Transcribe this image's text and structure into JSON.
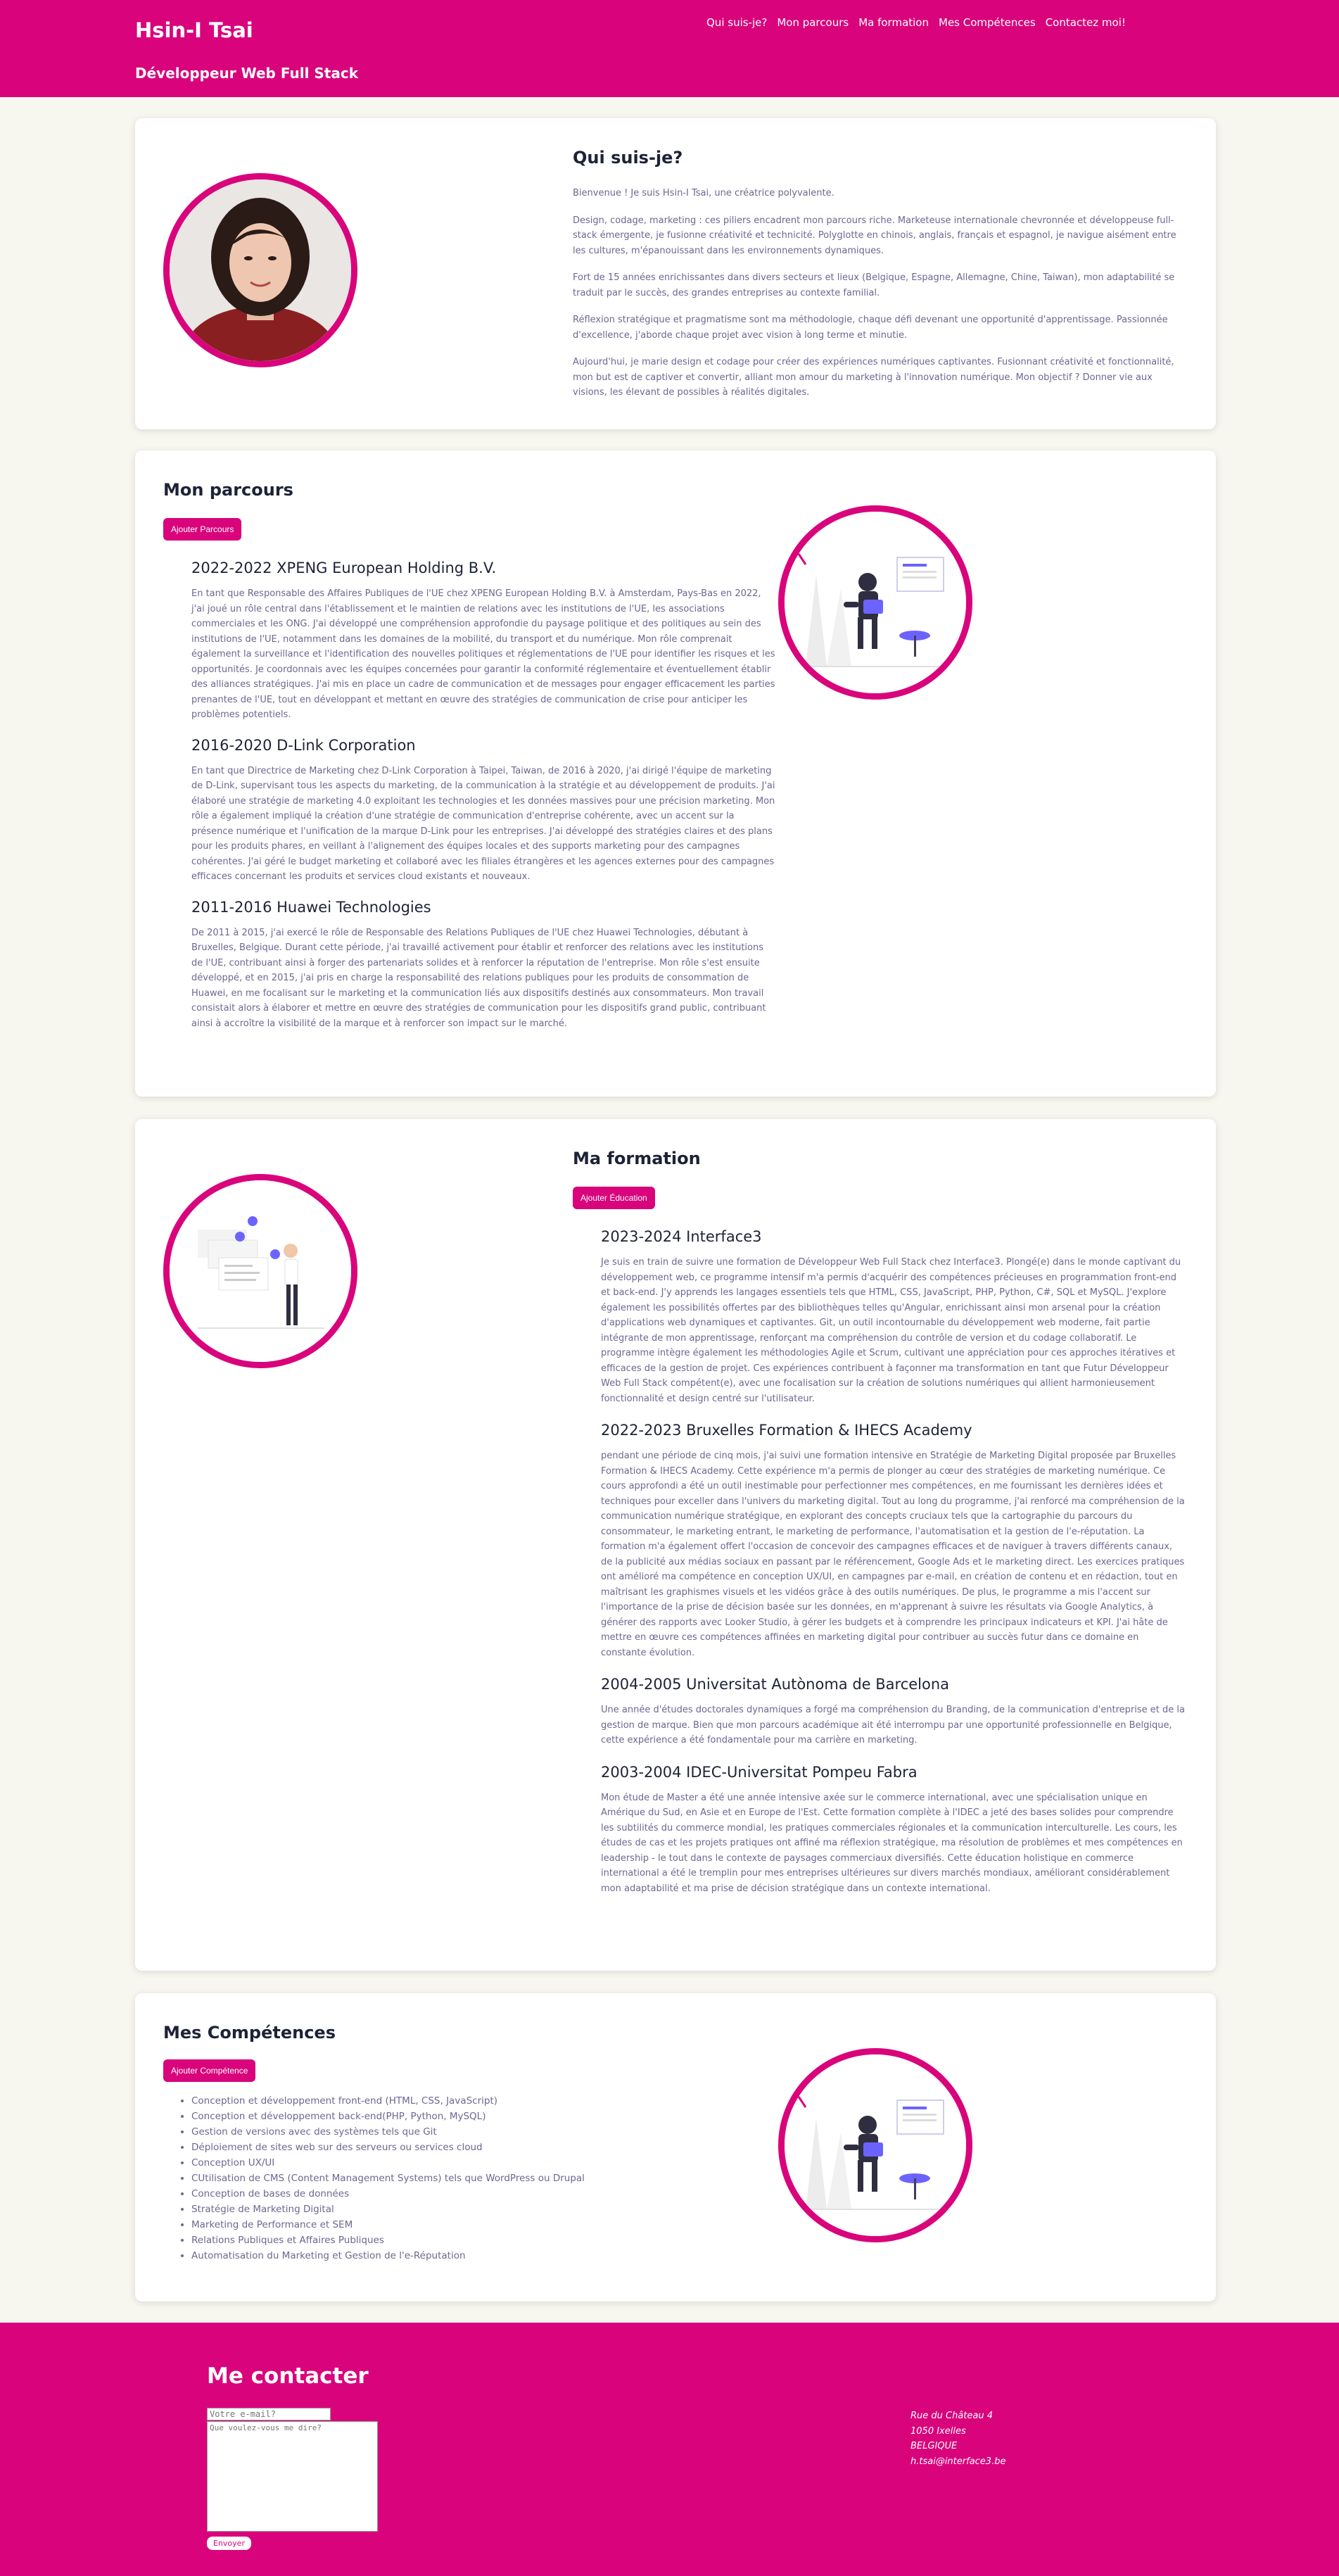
{
  "header": {
    "name": "Hsin-I Tsai",
    "role": "Développeur Web Full Stack",
    "nav": [
      "Qui suis-je?",
      "Mon parcours",
      "Ma formation",
      "Mes Compétences",
      "Contactez moi!"
    ]
  },
  "about": {
    "title": "Qui suis-je?",
    "paragraphs": [
      "Bienvenue ! Je suis Hsin-I Tsai, une créatrice polyvalente.",
      "Design, codage, marketing : ces piliers encadrent mon parcours riche. Marketeuse internationale chevronnée et développeuse full-stack émergente, je fusionne créativité et technicité. Polyglotte en chinois, anglais, français et espagnol, je navigue aisément entre les cultures, m'épanouissant dans les environnements dynamiques.",
      "Fort de 15 années enrichissantes dans divers secteurs et lieux (Belgique, Espagne, Allemagne, Chine, Taiwan), mon adaptabilité se traduit par le succès, des grandes entreprises au contexte familial.",
      "Réflexion stratégique et pragmatisme sont ma méthodologie, chaque défi devenant une opportunité d'apprentissage. Passionnée d'excellence, j'aborde chaque projet avec vision à long terme et minutie.",
      "Aujourd'hui, je marie design et codage pour créer des expériences numériques captivantes. Fusionnant créativité et fonctionnalité, mon but est de captiver et convertir, alliant mon amour du marketing à l'innovation numérique. Mon objectif ? Donner vie aux visions, les élevant de possibles à réalités digitales."
    ]
  },
  "parcours": {
    "title": "Mon parcours",
    "add_label": "Ajouter Parcours",
    "items": [
      {
        "title": "2022-2022 XPENG European Holding B.V.",
        "text": "En tant que Responsable des Affaires Publiques de l'UE chez XPENG European Holding B.V. à Amsterdam, Pays-Bas en 2022, j'ai joué un rôle central dans l'établissement et le maintien de relations avec les institutions de l'UE, les associations commerciales et les ONG. J'ai développé une compréhension approfondie du paysage politique et des politiques au sein des institutions de l'UE, notamment dans les domaines de la mobilité, du transport et du numérique. Mon rôle comprenait également la surveillance et l'identification des nouvelles politiques et réglementations de l'UE pour identifier les risques et les opportunités. Je coordonnais avec les équipes concernées pour garantir la conformité réglementaire et éventuellement établir des alliances stratégiques. J'ai mis en place un cadre de communication et de messages pour engager efficacement les parties prenantes de l'UE, tout en développant et mettant en œuvre des stratégies de communication de crise pour anticiper les problèmes potentiels."
      },
      {
        "title": "2016-2020 D-Link Corporation",
        "text": "En tant que Directrice de Marketing chez D-Link Corporation à Taipei, Taiwan, de 2016 à 2020, j'ai dirigé l'équipe de marketing de D-Link, supervisant tous les aspects du marketing, de la communication à la stratégie et au développement de produits. J'ai élaboré une stratégie de marketing 4.0 exploitant les technologies et les données massives pour une précision marketing. Mon rôle a également impliqué la création d'une stratégie de communication d'entreprise cohérente, avec un accent sur la présence numérique et l'unification de la marque D-Link pour les entreprises. J'ai développé des stratégies claires et des plans pour les produits phares, en veillant à l'alignement des équipes locales et des supports marketing pour des campagnes cohérentes. J'ai géré le budget marketing et collaboré avec les filiales étrangères et les agences externes pour des campagnes efficaces concernant les produits et services cloud existants et nouveaux."
      },
      {
        "title": "2011-2016 Huawei Technologies",
        "text": "De 2011 à 2015, j'ai exercé le rôle de Responsable des Relations Publiques de l'UE chez Huawei Technologies, débutant à Bruxelles, Belgique. Durant cette période, j'ai travaillé activement pour établir et renforcer des relations avec les institutions de l'UE, contribuant ainsi à forger des partenariats solides et à renforcer la réputation de l'entreprise. Mon rôle s'est ensuite développé, et en 2015, j'ai pris en charge la responsabilité des relations publiques pour les produits de consommation de Huawei, en me focalisant sur le marketing et la communication liés aux dispositifs destinés aux consommateurs. Mon travail consistait alors à élaborer et mettre en œuvre des stratégies de communication pour les dispositifs grand public, contribuant ainsi à accroître la visibilité de la marque et à renforcer son impact sur le marché."
      }
    ]
  },
  "formation": {
    "title": "Ma formation",
    "add_label": "Ajouter Éducation",
    "items": [
      {
        "title": "2023-2024 Interface3",
        "text": "Je suis en train de suivre une formation de Développeur Web Full Stack chez Interface3. Plongé(e) dans le monde captivant du développement web, ce programme intensif m'a permis d'acquérir des compétences précieuses en programmation front-end et back-end. J'y apprends les langages essentiels tels que HTML, CSS, JavaScript, PHP, Python, C#, SQL et MySQL. J'explore également les possibilités offertes par des bibliothèques telles qu'Angular, enrichissant ainsi mon arsenal pour la création d'applications web dynamiques et captivantes. Git, un outil incontournable du développement web moderne, fait partie intégrante de mon apprentissage, renforçant ma compréhension du contrôle de version et du codage collaboratif. Le programme intègre également les méthodologies Agile et Scrum, cultivant une appréciation pour ces approches itératives et efficaces de la gestion de projet. Ces expériences contribuent à façonner ma transformation en tant que Futur Développeur Web Full Stack compétent(e), avec une focalisation sur la création de solutions numériques qui allient harmonieusement fonctionnalité et design centré sur l'utilisateur."
      },
      {
        "title": "2022-2023 Bruxelles Formation & IHECS Academy",
        "text": "pendant une période de cinq mois, j'ai suivi une formation intensive en Stratégie de Marketing Digital proposée par Bruxelles Formation & IHECS Academy. Cette expérience m'a permis de plonger au cœur des stratégies de marketing numérique. Ce cours approfondi a été un outil inestimable pour perfectionner mes compétences, en me fournissant les dernières idées et techniques pour exceller dans l'univers du marketing digital. Tout au long du programme, j'ai renforcé ma compréhension de la communication numérique stratégique, en explorant des concepts cruciaux tels que la cartographie du parcours du consommateur, le marketing entrant, le marketing de performance, l'automatisation et la gestion de l'e-réputation. La formation m'a également offert l'occasion de concevoir des campagnes efficaces et de naviguer à travers différents canaux, de la publicité aux médias sociaux en passant par le référencement, Google Ads et le marketing direct. Les exercices pratiques ont amélioré ma compétence en conception UX/UI, en campagnes par e-mail, en création de contenu et en rédaction, tout en maîtrisant les graphismes visuels et les vidéos grâce à des outils numériques. De plus, le programme a mis l'accent sur l'importance de la prise de décision basée sur les données, en m'apprenant à suivre les résultats via Google Analytics, à générer des rapports avec Looker Studio, à gérer les budgets et à comprendre les principaux indicateurs et KPI. J'ai hâte de mettre en œuvre ces compétences affinées en marketing digital pour contribuer au succès futur dans ce domaine en constante évolution."
      },
      {
        "title": "2004-2005 Universitat Autònoma de Barcelona",
        "text": "Une année d'études doctorales dynamiques a forgé ma compréhension du Branding, de la communication d'entreprise et de la gestion de marque. Bien que mon parcours académique ait été interrompu par une opportunité professionnelle en Belgique, cette expérience a été fondamentale pour ma carrière en marketing."
      },
      {
        "title": "2003-2004 IDEC-Universitat Pompeu Fabra",
        "text": "Mon étude de Master a été une année intensive axée sur le commerce international, avec une spécialisation unique en Amérique du Sud, en Asie et en Europe de l'Est. Cette formation complète à l'IDEC a jeté des bases solides pour comprendre les subtilités du commerce mondial, les pratiques commerciales régionales et la communication interculturelle. Les cours, les études de cas et les projets pratiques ont affiné ma réflexion stratégique, ma résolution de problèmes et mes compétences en leadership - le tout dans le contexte de paysages commerciaux diversifiés. Cette éducation holistique en commerce international a été le tremplin pour mes entreprises ultérieures sur divers marchés mondiaux, améliorant considérablement mon adaptabilité et ma prise de décision stratégique dans un contexte international."
      }
    ]
  },
  "skills": {
    "title": "Mes Compétences",
    "add_label": "Ajouter Compétence",
    "items": [
      "Conception et développement front-end (HTML, CSS, JavaScript)",
      "Conception et développement back-end(PHP, Python, MySQL)",
      "Gestion de versions avec des systèmes tels que Git",
      "Déploiement de sites web sur des serveurs ou services cloud",
      "Conception UX/UI",
      "CUtilisation de CMS (Content Management Systems) tels que WordPress ou Drupal",
      "Conception de bases de données",
      "Stratégie de Marketing Digital",
      "Marketing de Performance et SEM",
      "Relations Publiques et Affaires Publiques",
      "Automatisation du Marketing et Gestion de l'e-Réputation"
    ]
  },
  "contact": {
    "title": "Me contacter",
    "email_placeholder": "Votre e-mail?",
    "message_placeholder": "Que voulez-vous me dire?",
    "send_label": "Envoyer",
    "address": [
      "Rue du Château 4",
      "1050 Ixelles",
      "BELGIQUE",
      "h.tsai@interface3.be"
    ]
  },
  "colors": {
    "accent": "#d9047c",
    "background": "#f7f7ef",
    "heading": "#1d2236",
    "text": "#6b6890"
  }
}
